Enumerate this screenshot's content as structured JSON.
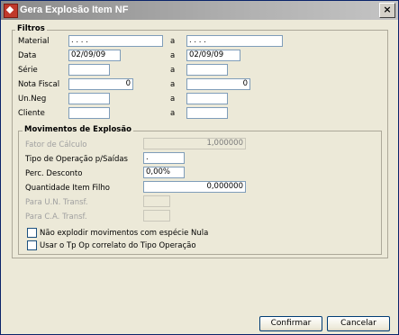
{
  "window": {
    "title": "Gera Explosão Item NF",
    "close": "×"
  },
  "filtros": {
    "title": "Filtros",
    "a_label": "a",
    "rows": [
      {
        "label": "Material",
        "from": ".    .    .    .",
        "to": ".    .    .    ."
      },
      {
        "label": "Data",
        "from": "02/09/09",
        "to": "02/09/09"
      },
      {
        "label": "Série",
        "from": "",
        "to": ""
      },
      {
        "label": "Nota Fiscal",
        "from": "0",
        "to": "0"
      },
      {
        "label": "Un.Neg",
        "from": "",
        "to": ""
      },
      {
        "label": "Cliente",
        "from": "",
        "to": ""
      }
    ]
  },
  "movimentos": {
    "title": "Movimentos de Explosão",
    "fator_label": "Fator de Cálculo",
    "fator_value": "1,000000",
    "tipo_op_label": "Tipo de Operação p/Saídas",
    "tipo_op_value": ".",
    "perc_label": "Perc. Desconto",
    "perc_value": "0,00%",
    "qtd_label": "Quantidade Item Filho",
    "qtd_value": "0,000000",
    "un_label": "Para U.N. Transf.",
    "ca_label": "Para C.A. Transf.",
    "chk1_label": "Não explodir movimentos com espécie Nula",
    "chk2_label": "Usar o Tp Op correlato do Tipo Operação"
  },
  "buttons": {
    "confirm": "Confirmar",
    "cancel": "Cancelar"
  }
}
